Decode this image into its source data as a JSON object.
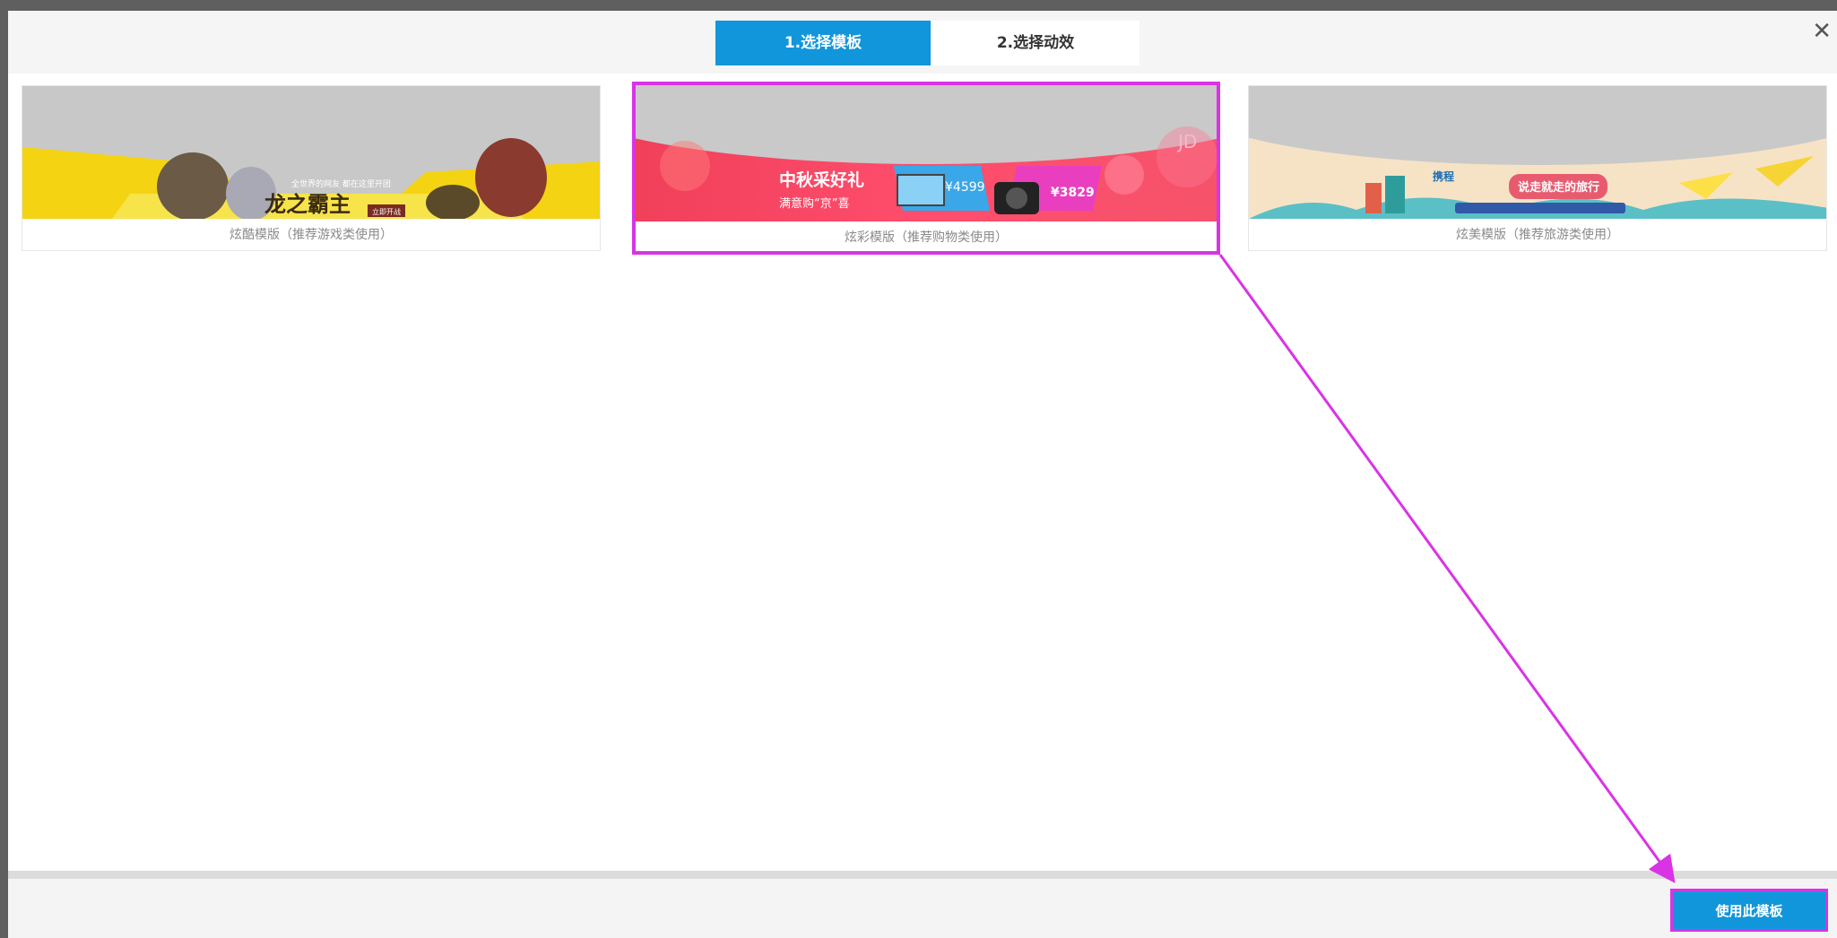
{
  "tabs": [
    {
      "label": "1.选择模板",
      "active": true
    },
    {
      "label": "2.选择动效",
      "active": false
    }
  ],
  "close_icon": "close-icon",
  "templates": [
    {
      "caption": "炫酷模版（推荐游戏类使用）",
      "banner_text": [
        "全世界的网友 都在这里开团",
        "龙之霸主",
        "立即开战"
      ]
    },
    {
      "caption": "炫彩模版（推荐购物类使用）",
      "selected": true,
      "banner_text": [
        "中秋采好礼",
        "满意购“京”喜",
        "¥4599",
        "¥3829",
        "JD"
      ]
    },
    {
      "caption": "炫美模版（推荐旅游类使用）",
      "banner_text": [
        "携程",
        "说走就走的旅行"
      ]
    }
  ],
  "footer": {
    "use_button": "使用此模板"
  },
  "colors": {
    "accent": "#1296db",
    "highlight": "#d933e6"
  }
}
